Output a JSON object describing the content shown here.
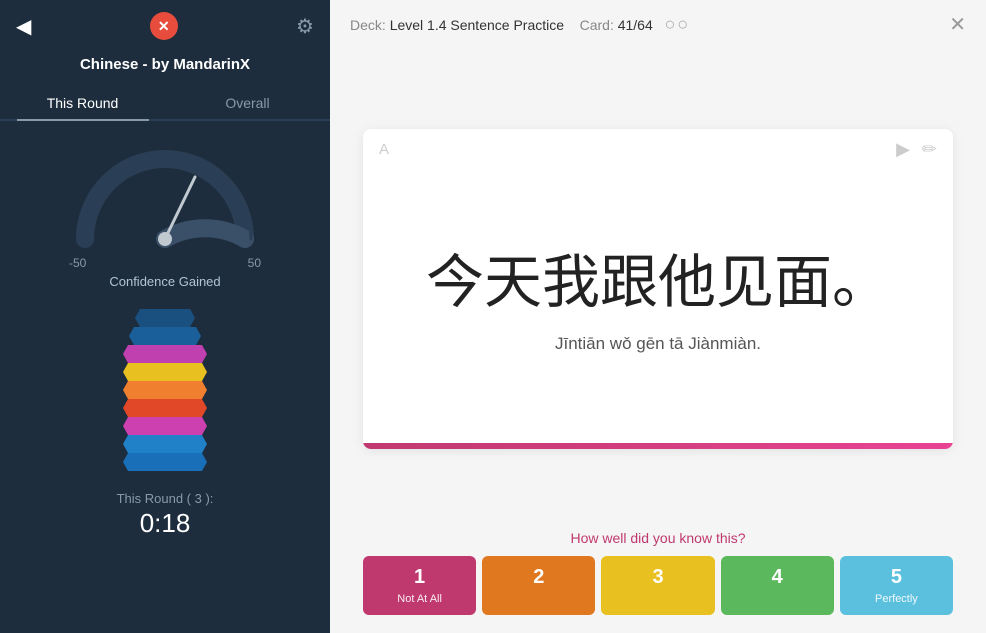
{
  "left": {
    "back_icon": "◀",
    "close_label": "✕",
    "settings_icon": "⚙",
    "deck_title": "Chinese - by MandarinX",
    "tabs": [
      {
        "id": "this-round",
        "label": "This Round",
        "active": true
      },
      {
        "id": "overall",
        "label": "Overall",
        "active": false
      }
    ],
    "gauge": {
      "min_label": "-50",
      "max_label": "50",
      "confidence_label": "Confidence Gained"
    },
    "chevrons": [
      {
        "color": "#1a6fa8"
      },
      {
        "color": "#1a7fc4"
      },
      {
        "color": "#d44fbf"
      },
      {
        "color": "#e8c020"
      },
      {
        "color": "#f08030"
      },
      {
        "color": "#e05030"
      },
      {
        "color": "#d44fbf"
      },
      {
        "color": "#1a7fc4"
      },
      {
        "color": "#1a6fa8"
      }
    ],
    "round_label": "This Round ( 3 ):",
    "round_time": "0:18"
  },
  "right": {
    "header": {
      "deck_label": "Deck:",
      "deck_name": "Level 1.4 Sentence Practice",
      "card_label": "Card:",
      "card_value": "41/64",
      "close_icon": "✕"
    },
    "card": {
      "side_label": "A",
      "play_icon": "▶",
      "edit_icon": "✏",
      "chinese": "今天我跟他见面。",
      "pinyin": "Jīntiān wǒ gēn tā Jiànmiàn."
    },
    "rating": {
      "question": "How well did you know this?",
      "buttons": [
        {
          "num": "1",
          "label": "Not At All",
          "class": "btn-1"
        },
        {
          "num": "2",
          "label": "",
          "class": "btn-2"
        },
        {
          "num": "3",
          "label": "",
          "class": "btn-3"
        },
        {
          "num": "4",
          "label": "",
          "class": "btn-4"
        },
        {
          "num": "5",
          "label": "Perfectly",
          "class": "btn-5"
        }
      ]
    }
  }
}
